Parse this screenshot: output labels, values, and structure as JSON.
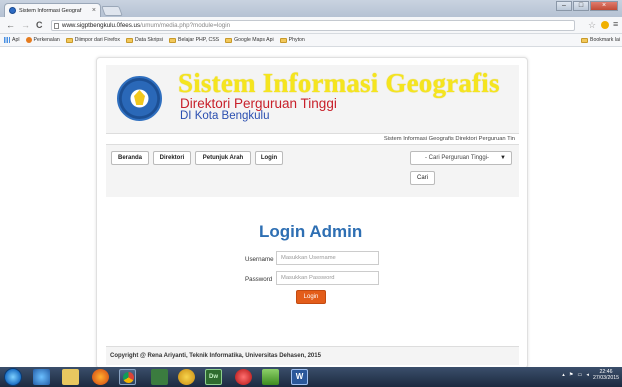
{
  "browser": {
    "tab_title": "Sistem Informasi Geograf",
    "tab_close": "×",
    "url_host": "www.sigptbengkulu.0fees.us",
    "url_path": "/umum/media.php?module=login",
    "nav_back": "←",
    "nav_forward": "→",
    "nav_reload": "C",
    "bookmarks": [
      "Apl",
      "Perkenalan",
      "Diimpor dari Firefox",
      "Data Skripsi",
      "Belajar PHP, CSS",
      "Google Maps Api",
      "Phyton"
    ],
    "bookmarks_other": "Bookmark lai"
  },
  "header": {
    "title": "Sistem Informasi Geografis",
    "subtitle1": "Direktori Perguruan Tinggi",
    "subtitle2": "DI Kota Bengkulu",
    "marquee": "Sistem Informasi Geografis Direktori Perguruan Tin"
  },
  "nav": {
    "items": [
      "Beranda",
      "Direktori",
      "Petunjuk Arah",
      "Login"
    ],
    "select_value": "- Cari Perguruan Tinggi-",
    "search_button": "Cari"
  },
  "login": {
    "title": "Login Admin",
    "username_label": "Username",
    "username_placeholder": "Masukkan Username",
    "password_label": "Password",
    "password_placeholder": "Masukkan Password",
    "submit": "Login"
  },
  "footer": {
    "text": "Copyright @ Rena Ariyanti, Teknik Informatika, Universitas Dehasen, 2015"
  },
  "taskbar": {
    "time": "22:46",
    "date": "27/03/2015"
  }
}
